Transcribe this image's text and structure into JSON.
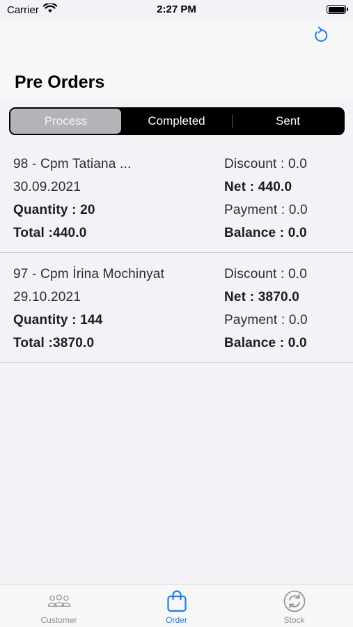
{
  "status_bar": {
    "carrier": "Carrier",
    "time": "2:27 PM"
  },
  "header": {
    "title": "Pre Orders",
    "refresh_icon": "refresh-icon"
  },
  "segments": [
    {
      "label": "Process",
      "selected": true
    },
    {
      "label": "Completed",
      "selected": false
    },
    {
      "label": "Sent",
      "selected": false
    }
  ],
  "orders": [
    {
      "name": "98 - Cpm Tatiana ...",
      "date": "30.09.2021",
      "quantity": "Quantity : 20",
      "total": "Total :440.0",
      "discount": "Discount : 0.0",
      "net": "Net : 440.0",
      "payment": "Payment : 0.0",
      "balance": "Balance : 0.0"
    },
    {
      "name": "97 - Cpm İrina Mochinyat",
      "date": "29.10.2021",
      "quantity": "Quantity : 144",
      "total": "Total :3870.0",
      "discount": "Discount : 0.0",
      "net": "Net : 3870.0",
      "payment": "Payment : 0.0",
      "balance": "Balance : 0.0"
    }
  ],
  "tabs": [
    {
      "label": "Customer",
      "icon": "people-icon",
      "active": false
    },
    {
      "label": "Order",
      "icon": "bag-icon",
      "active": true
    },
    {
      "label": "Stock",
      "icon": "sync-icon",
      "active": false
    }
  ],
  "colors": {
    "accent": "#1a7cf5",
    "segment_bg": "#000000",
    "segment_selected": "#b4b4b8",
    "inactive_tab": "#8e8e93"
  }
}
